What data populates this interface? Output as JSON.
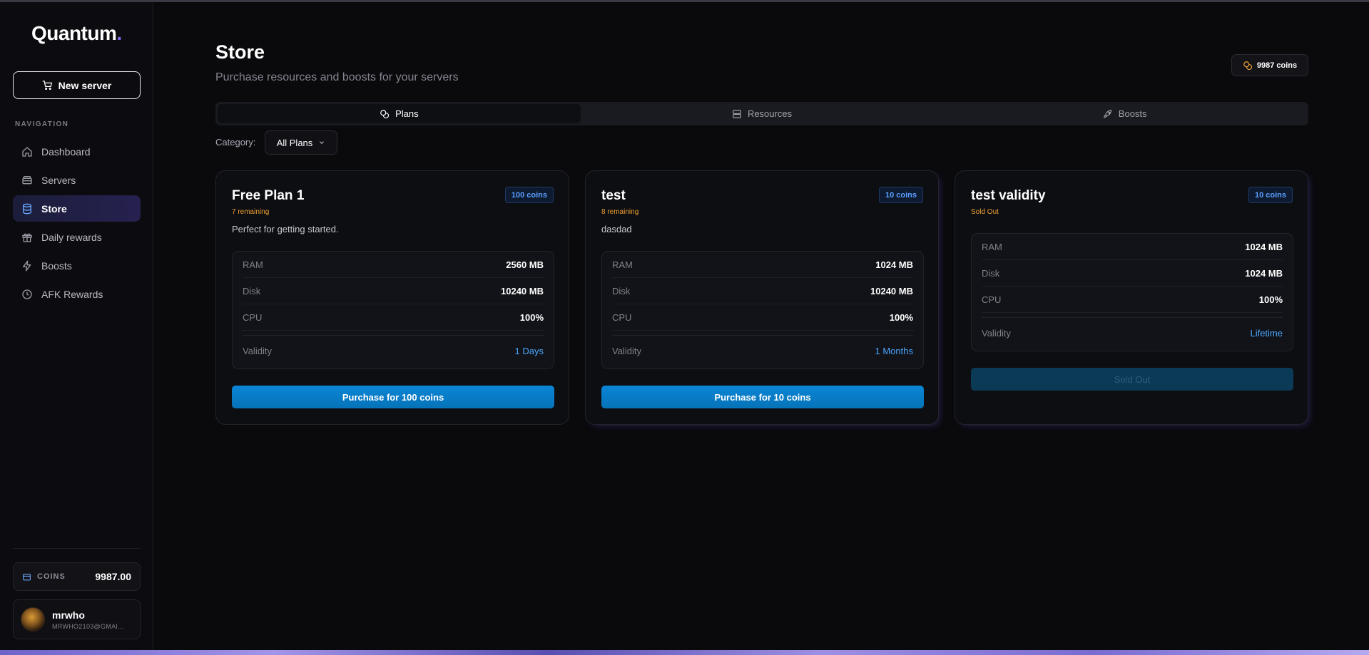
{
  "app": {
    "logo": "Quantum",
    "logo_dot": "."
  },
  "sidebar": {
    "new_server_label": "New server",
    "nav_heading": "NAVIGATION",
    "items": [
      {
        "label": "Dashboard",
        "icon": "home-icon"
      },
      {
        "label": "Servers",
        "icon": "server-icon"
      },
      {
        "label": "Store",
        "icon": "database-icon",
        "active": true
      },
      {
        "label": "Daily rewards",
        "icon": "gift-icon"
      },
      {
        "label": "Boosts",
        "icon": "lightning-icon"
      },
      {
        "label": "AFK Rewards",
        "icon": "clock-icon"
      }
    ],
    "coins_label": "COINS",
    "coins_value": "9987.00",
    "user": {
      "name": "mrwho",
      "email": "MRWHO2103@GMAI..."
    }
  },
  "header": {
    "title": "Store",
    "subtitle": "Purchase resources and boosts for your servers",
    "coins_badge": "9987 coins"
  },
  "tabs": [
    {
      "label": "Plans",
      "icon": "coins-icon",
      "active": true
    },
    {
      "label": "Resources",
      "icon": "server-icon"
    },
    {
      "label": "Boosts",
      "icon": "rocket-icon"
    }
  ],
  "filter": {
    "label": "Category:",
    "value": "All Plans"
  },
  "plans": [
    {
      "title": "Free Plan 1",
      "price": "100 coins",
      "remaining": "7 remaining",
      "description": "Perfect for getting started.",
      "specs": [
        {
          "k": "RAM",
          "v": "2560 MB"
        },
        {
          "k": "Disk",
          "v": "10240 MB"
        },
        {
          "k": "CPU",
          "v": "100%"
        }
      ],
      "validity_label": "Validity",
      "validity": "1 Days",
      "button": "Purchase for 100 coins"
    },
    {
      "title": "test",
      "price": "10 coins",
      "remaining": "8 remaining",
      "description": "dasdad",
      "specs": [
        {
          "k": "RAM",
          "v": "1024 MB"
        },
        {
          "k": "Disk",
          "v": "10240 MB"
        },
        {
          "k": "CPU",
          "v": "100%"
        }
      ],
      "validity_label": "Validity",
      "validity": "1 Months",
      "button": "Purchase for 10 coins"
    },
    {
      "title": "test validity",
      "price": "10 coins",
      "remaining": "Sold Out",
      "description": "",
      "specs": [
        {
          "k": "RAM",
          "v": "1024 MB"
        },
        {
          "k": "Disk",
          "v": "1024 MB"
        },
        {
          "k": "CPU",
          "v": "100%"
        }
      ],
      "validity_label": "Validity",
      "validity": "Lifetime",
      "button": "Sold Out"
    }
  ],
  "colors": {
    "accent": "#7c6cf0",
    "primary_button": "#0a86d6",
    "warning": "#f0a030",
    "link": "#4aa6ff"
  }
}
